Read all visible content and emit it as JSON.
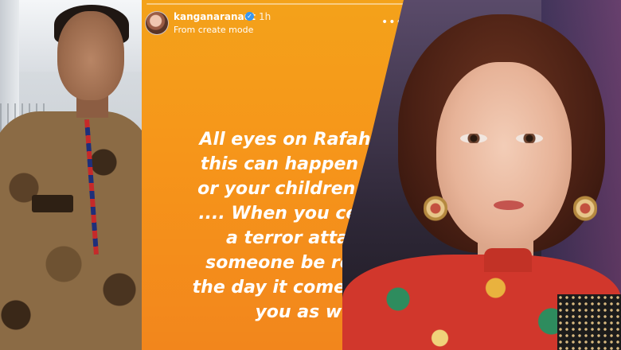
{
  "story": {
    "username": "kanganaranaut",
    "verified_glyph": "✓",
    "timestamp": "1h",
    "subtitle": "From create mode",
    "more_glyph": "•••",
    "close_glyph": "✕",
    "lines": [
      "All eyes on Rafah Gang",
      "this can happen to you",
      "or your children as well",
      ".... When you celebrate",
      "a terror attack on",
      "someone be ready for",
      "the day it comes back to",
      "you as well."
    ],
    "background_colors": [
      "#f4a21a",
      "#f2861c"
    ]
  },
  "images": {
    "left": "security-officer-photo",
    "right": "actress-portrait-photo"
  }
}
